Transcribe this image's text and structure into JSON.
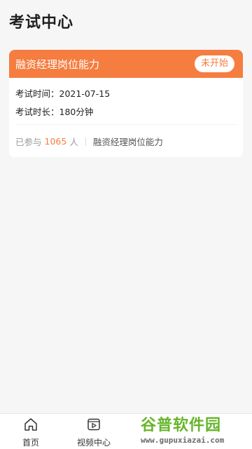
{
  "page": {
    "title": "考试中心"
  },
  "exam_card": {
    "title": "融资经理岗位能力",
    "status": "未开始",
    "time_label": "考试时间：",
    "time_value": "2021-07-15",
    "duration_label": "考试时长：",
    "duration_value": "180分钟",
    "participants_prefix": "已参与",
    "participants_count": "1065",
    "participants_suffix": "人",
    "category": "融资经理岗位能力"
  },
  "tabbar": {
    "items": [
      {
        "label": "首页",
        "icon": "home-icon"
      },
      {
        "label": "视频中心",
        "icon": "video-icon"
      }
    ]
  },
  "watermark": {
    "brand": "谷普软件园",
    "url": "www.gupuxiazai.com"
  },
  "colors": {
    "accent": "#f57d3f",
    "background": "#f6f6f7",
    "watermark_green": "#66b52a"
  }
}
